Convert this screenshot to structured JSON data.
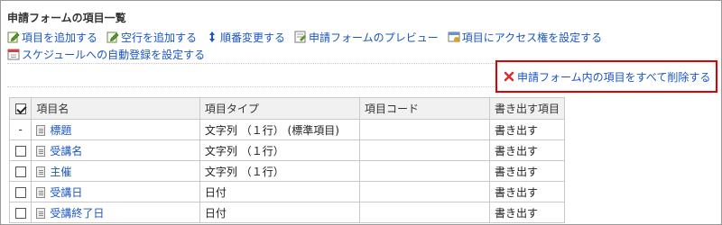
{
  "section_title": "申請フォームの項目一覧",
  "actions": [
    {
      "label": "項目を追加する",
      "icon": "edit-icon"
    },
    {
      "label": "空行を追加する",
      "icon": "edit-icon"
    },
    {
      "label": "順番変更する",
      "icon": "sort-arrows-icon"
    },
    {
      "label": "申請フォームのプレビュー",
      "icon": "form-preview-icon"
    },
    {
      "label": "項目にアクセス権を設定する",
      "icon": "access-rights-icon"
    },
    {
      "label": "スケジュールへの自動登録を設定する",
      "icon": "calendar-icon"
    }
  ],
  "delete_all": {
    "label": "申請フォーム内の項目をすべて削除する",
    "icon": "delete-x-icon",
    "highlight_color": "#e00000"
  },
  "table": {
    "headers": {
      "name": "項目名",
      "type": "項目タイプ",
      "code": "項目コード",
      "output": "書き出す項目"
    },
    "rows": [
      {
        "check": "-",
        "name": "標題",
        "type": "文字列 （１行） (標準項目)",
        "code": "",
        "output": "書き出す"
      },
      {
        "check": "",
        "name": "受講名",
        "type": "文字列 （１行）",
        "code": "",
        "output": "書き出す"
      },
      {
        "check": "",
        "name": "主催",
        "type": "文字列 （１行）",
        "code": "",
        "output": "書き出す"
      },
      {
        "check": "",
        "name": "受講日",
        "type": "日付",
        "code": "",
        "output": "書き出す"
      },
      {
        "check": "",
        "name": "受講終了日",
        "type": "日付",
        "code": "",
        "output": "書き出す"
      }
    ]
  },
  "colors": {
    "link": "#1a55c4",
    "header_bg": "#f1f1f1",
    "border": "#c9c9c9"
  }
}
